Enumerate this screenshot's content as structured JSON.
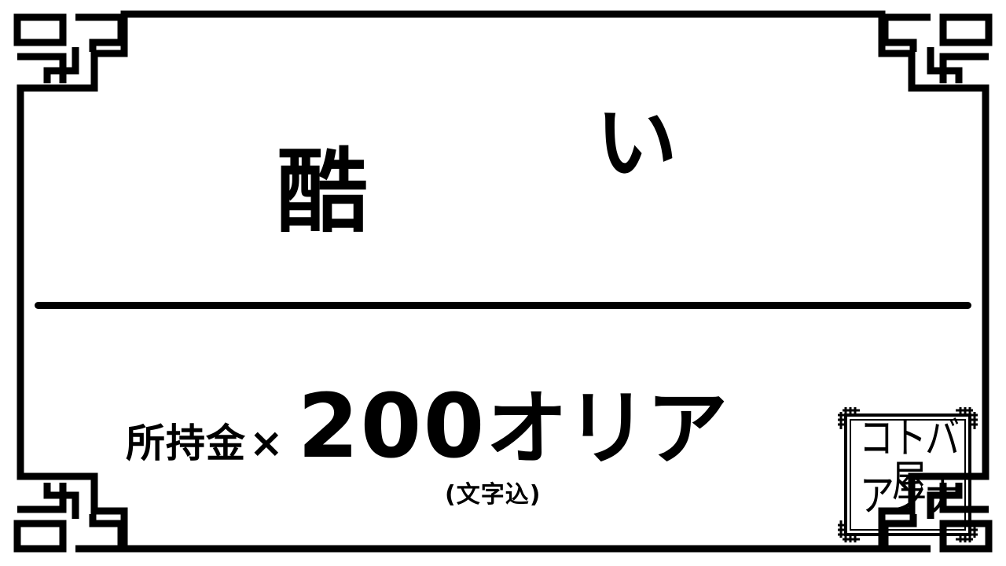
{
  "word": {
    "char_1": "酷",
    "char_2": "い"
  },
  "price": {
    "label": "所持金",
    "times": "×",
    "amount": "200",
    "unit": "オリア"
  },
  "note": "(文字込)",
  "stamp": {
    "line_1": "コトバ屋",
    "line_2": "アンナ"
  },
  "colors": {
    "background": "#ffffff",
    "ink": "#000000"
  }
}
